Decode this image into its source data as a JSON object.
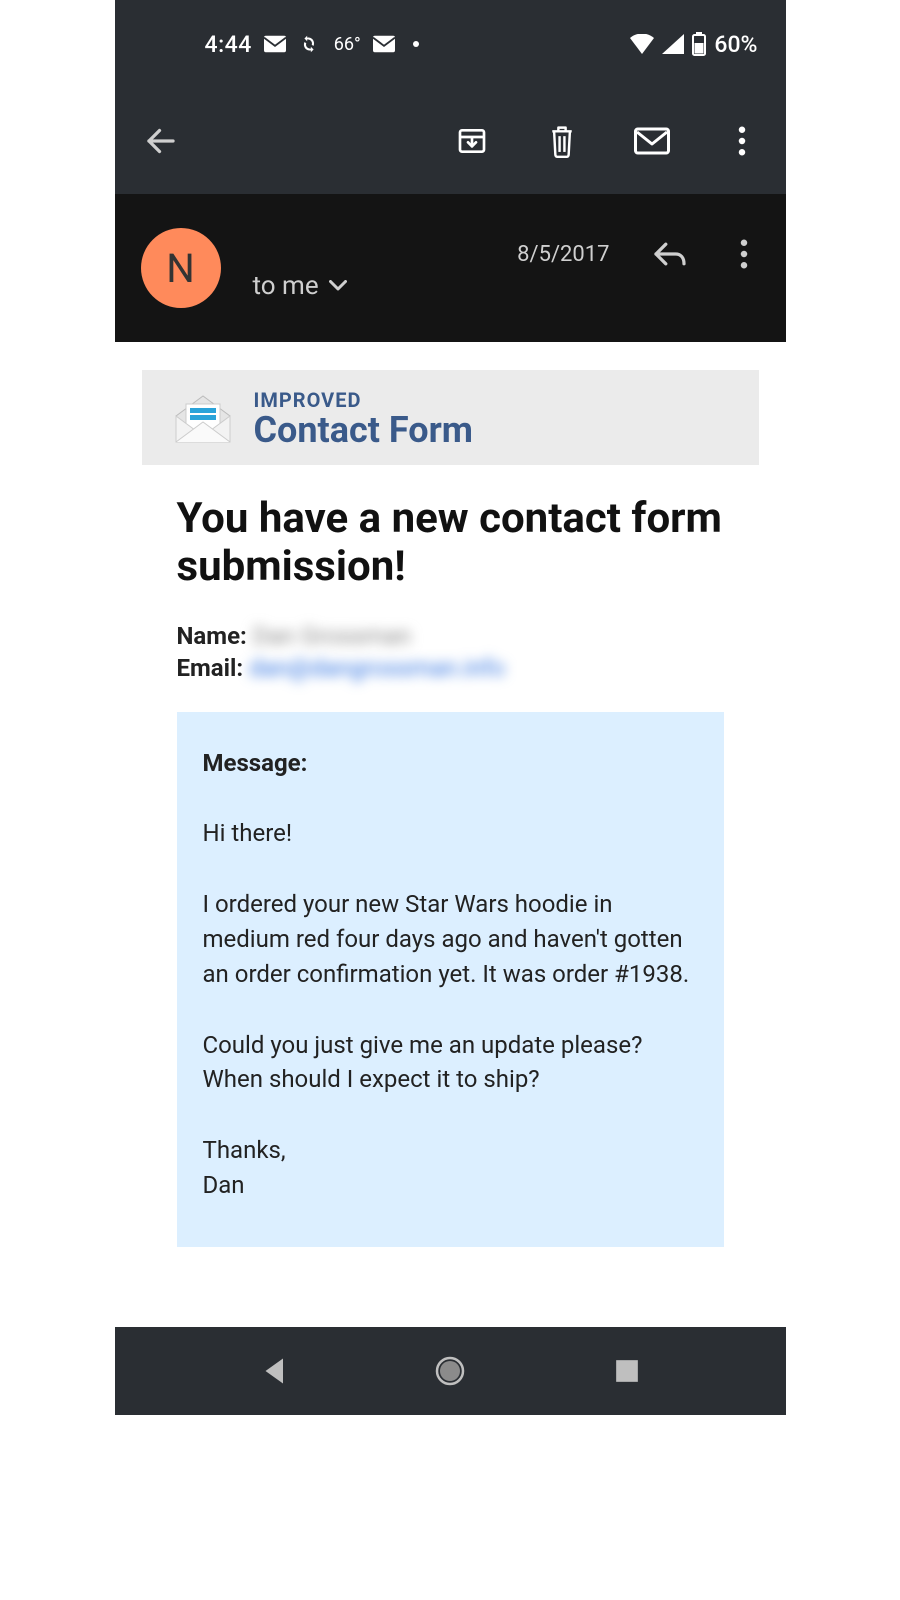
{
  "statusbar": {
    "time": "4:44",
    "temperature": "66°",
    "battery_text": "60%"
  },
  "appbar": {},
  "sender": {
    "avatar_initial": "N",
    "to_label": "to me",
    "date": "8/5/2017"
  },
  "banner": {
    "line1": "IMPROVED",
    "line2": "Contact Form"
  },
  "content": {
    "headline": "You have a new contact form submission!",
    "name_label": "Name:",
    "name_value": "Dan Grossman",
    "email_label": "Email:",
    "email_value": "dan@dangrossman.info",
    "message_label": "Message:",
    "paragraphs": [
      "Hi there!",
      "I ordered your new Star Wars hoodie in medium red four days ago and haven't gotten an order confirmation yet. It was order #1938.",
      "Could you just give me an update please? When should I expect it to ship?",
      "Thanks,\nDan"
    ]
  }
}
